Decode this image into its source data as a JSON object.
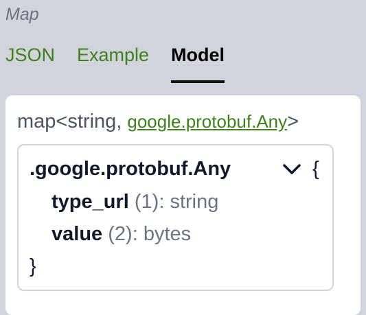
{
  "section": {
    "label": "Map"
  },
  "tabs": [
    {
      "label": "JSON",
      "active": false
    },
    {
      "label": "Example",
      "active": false
    },
    {
      "label": "Model",
      "active": true
    }
  ],
  "map_type": {
    "prefix": "map<string, ",
    "value_type_link": "google.protobuf.Any",
    "suffix": ">"
  },
  "model": {
    "name": ".google.protobuf.Any",
    "toggle_icon": "chevron-down-icon",
    "open_brace": "{",
    "close_brace": "}",
    "fields": [
      {
        "name": "type_url",
        "number": "(1)",
        "type": "string"
      },
      {
        "name": "value",
        "number": "(2)",
        "type": "bytes"
      }
    ]
  },
  "colors": {
    "background": "#d1d5db",
    "link_green": "#3f7f1f",
    "card": "#ffffff",
    "muted_text": "#6b7280"
  }
}
